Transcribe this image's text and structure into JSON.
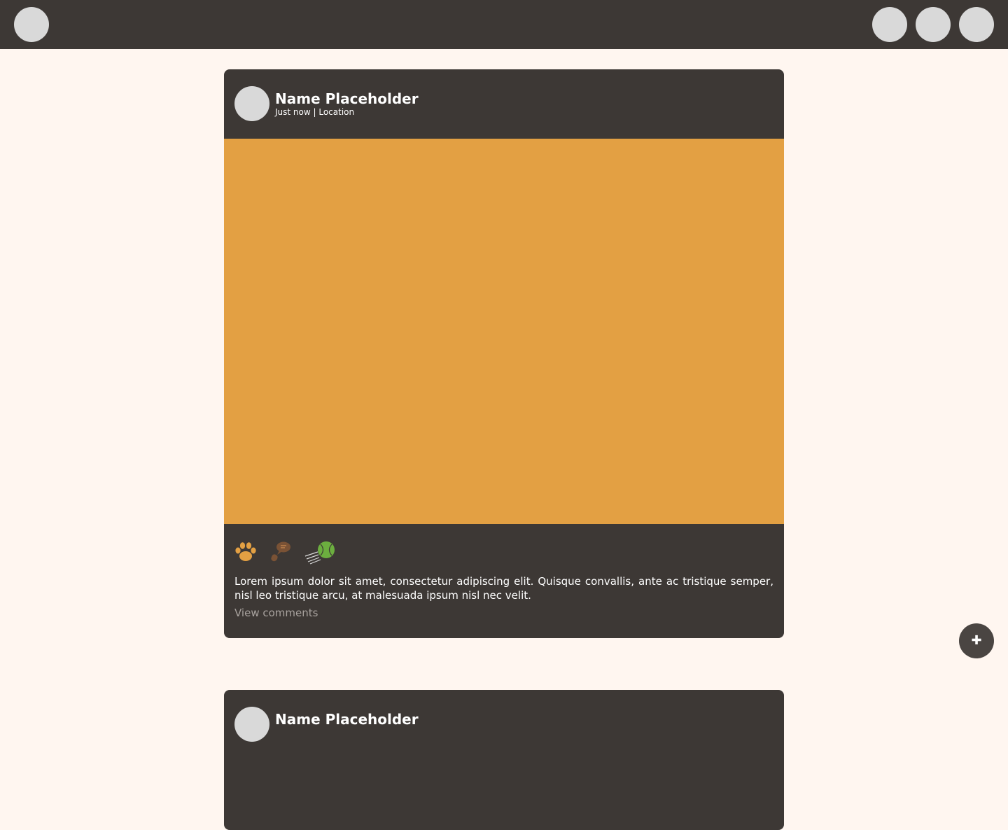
{
  "colors": {
    "page_background": "#fff6f0",
    "topbar": "#3d3835",
    "card": "#3d3835",
    "placeholder_circle": "#d9d9d9",
    "image_placeholder": "#e3a043",
    "muted_text": "#a8a29e",
    "fab": "#4a4542"
  },
  "topbar": {
    "left_icons": [
      "avatar-placeholder"
    ],
    "right_icons": [
      "nav-placeholder",
      "nav-placeholder",
      "nav-placeholder"
    ]
  },
  "posts": [
    {
      "author_name": "Name Placeholder",
      "meta": "Just now | Location",
      "reactions": [
        {
          "icon": "paw-icon"
        },
        {
          "icon": "comment-bubble-icon"
        },
        {
          "icon": "tennis-ball-icon"
        }
      ],
      "caption": "Lorem ipsum dolor sit amet, consectetur adipiscing elit. Quisque convallis, ante ac tristique semper, nisl leo tristique arcu, at malesuada ipsum nisl nec velit.",
      "view_comments_label": "View comments"
    },
    {
      "author_name": "Name Placeholder"
    }
  ],
  "fab": {
    "label": "✚",
    "icon": "plus-icon"
  }
}
